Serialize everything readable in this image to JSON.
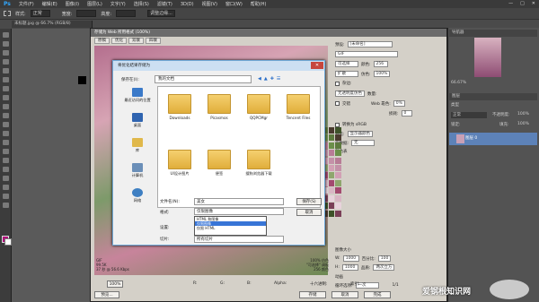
{
  "app": {
    "logo": "Ps",
    "menus": [
      "文件(F)",
      "编辑(E)",
      "图像(I)",
      "图层(L)",
      "文字(Y)",
      "选择(S)",
      "滤镜(T)",
      "3D(D)",
      "视图(V)",
      "窗口(W)",
      "帮助(H)"
    ],
    "window_buttons": [
      "—",
      "□",
      "✕"
    ]
  },
  "options_bar": {
    "style_label": "样式:",
    "style_value": "正常",
    "width_label": "宽度:",
    "height_label": "高度:",
    "refine_button": "调整边缘..."
  },
  "doc_tab": "未标题.jpg @ 66.7% (RGB/8)",
  "colors": {
    "foreground": "#b0007a",
    "background": "#ffffff",
    "accent": "#3875d7",
    "folder": "#e8be4f"
  },
  "sfw": {
    "title": "存储为 Web 所用格式 (100%)",
    "tabs": [
      "原稿",
      "优化",
      "双联",
      "四联"
    ],
    "preset_label": "预设:",
    "preset_value": "[未命名]",
    "format_value": "GIF",
    "reduction_value": "可选择",
    "dither_value": "扩散",
    "colors_label": "颜色:",
    "colors_value": "256",
    "dither_label": "仿色:",
    "dither_pct": "100%",
    "transparency_value": "无透明度仿色",
    "matte_label": "杂边:",
    "amount_label": "数量:",
    "interlaced_label": "交错",
    "web_snap_label": "Web 靠色:",
    "web_snap_value": "0%",
    "lossy_label": "损耗:",
    "lossy_value": "0",
    "convert_srgb": "转换为 sRGB",
    "preview_label": "预览:",
    "preview_value": "显示器颜色",
    "metadata_label": "元数据:",
    "metadata_value": "无",
    "color_table_label": "颜色表",
    "image_size_label": "图像大小",
    "w_label": "W:",
    "w_value": "1000",
    "h_label": "H:",
    "h_value": "1000",
    "px_label": "像素",
    "percent_label": "百分比:",
    "percent_value": "100",
    "quality_label": "品质:",
    "quality_value": "两次立方",
    "animation_label": "动画",
    "loop_label": "循环选项:",
    "loop_value": "一次",
    "frame_counter": "1/1",
    "info_left": [
      "GIF",
      "99.5K",
      "37 秒 @ 56.6 Kbps",
      ""
    ],
    "info_right": [
      "100% 仿色",
      "\"可选择\" 调板",
      "256 颜色"
    ],
    "zoom_value": "100%",
    "r_label": "R:",
    "g_label": "G:",
    "b_label": "B:",
    "alpha_label": "Alpha:",
    "hex_label": "十六进制:",
    "index_label": "索引:",
    "preview_button": "预览...",
    "save_button": "存储",
    "cancel_button": "取消",
    "done_button": "完成"
  },
  "saveas": {
    "title": "将优化结果存储为",
    "save_in_label": "保存在(I):",
    "location": "我的文档",
    "places": [
      "最近访问的位置",
      "桌面",
      "库",
      "计算机",
      "网络"
    ],
    "folders": [
      "Downloads",
      "Picasmos",
      "QQPCMgr",
      "Tencent Files",
      "UI设计图片",
      "便签",
      "搜狗浏览器下载"
    ],
    "filename_label": "文件名(N):",
    "filename_value": "美女",
    "format_label": "格式:",
    "format_value": "仅限图像",
    "settings_label": "设置:",
    "settings_value": "默认设置",
    "slices_label": "切片:",
    "slices_value": "所有切片",
    "dropdown_options": [
      "HTML 和图像",
      "仅限图像",
      "仅限 HTML"
    ],
    "save_button": "保存(S)",
    "cancel_button": "取消"
  },
  "right_panels": {
    "navigator": "导航器",
    "nav_zoom": "66.67%",
    "layers": "图层",
    "kind_label": "类型",
    "blend_mode": "正常",
    "opacity_label": "不透明度:",
    "opacity_value": "100%",
    "lock_label": "锁定:",
    "fill_label": "填充:",
    "fill_value": "100%",
    "layer_name": "图层 0"
  },
  "watermark": "爱钢根知识网"
}
